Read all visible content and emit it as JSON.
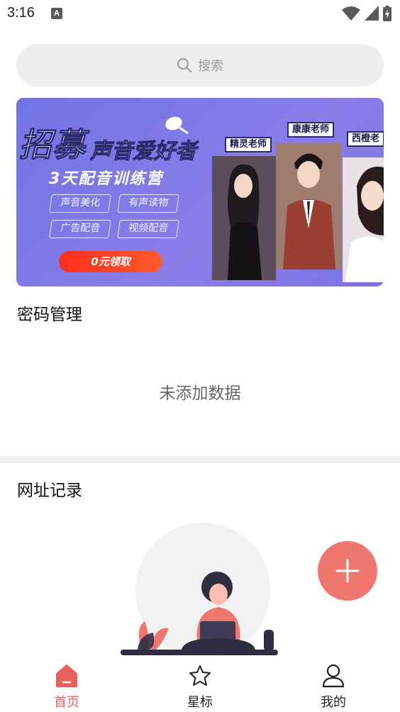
{
  "status_bar": {
    "time": "3:16",
    "notification_letter": "A",
    "icons": [
      "wifi-icon",
      "signal-icon",
      "battery-charging-icon"
    ]
  },
  "search": {
    "placeholder": "搜索",
    "icon": "search-icon"
  },
  "banner": {
    "title": "招募",
    "subtitle": "声音爱好者",
    "camp": "3天配音训练营",
    "tags": [
      "声音美化",
      "有声读物",
      "广告配音",
      "视频配音"
    ],
    "cta": "0元领取",
    "teachers": [
      "精灵老师",
      "康康老师",
      "西橙老"
    ]
  },
  "password_section": {
    "title": "密码管理",
    "empty_text": "未添加数据"
  },
  "url_section": {
    "title": "网址记录"
  },
  "fab": {
    "icon": "plus-icon"
  },
  "bottom_nav": {
    "items": [
      {
        "label": "首页",
        "icon": "home-icon",
        "active": true
      },
      {
        "label": "星标",
        "icon": "star-icon",
        "active": false
      },
      {
        "label": "我的",
        "icon": "user-icon",
        "active": false
      }
    ]
  },
  "colors": {
    "accent": "#e8625b",
    "fab": "#f07670",
    "banner_bg": "#7274e6",
    "search_bg": "#eeeeee",
    "divider": "#f1f1f1"
  }
}
